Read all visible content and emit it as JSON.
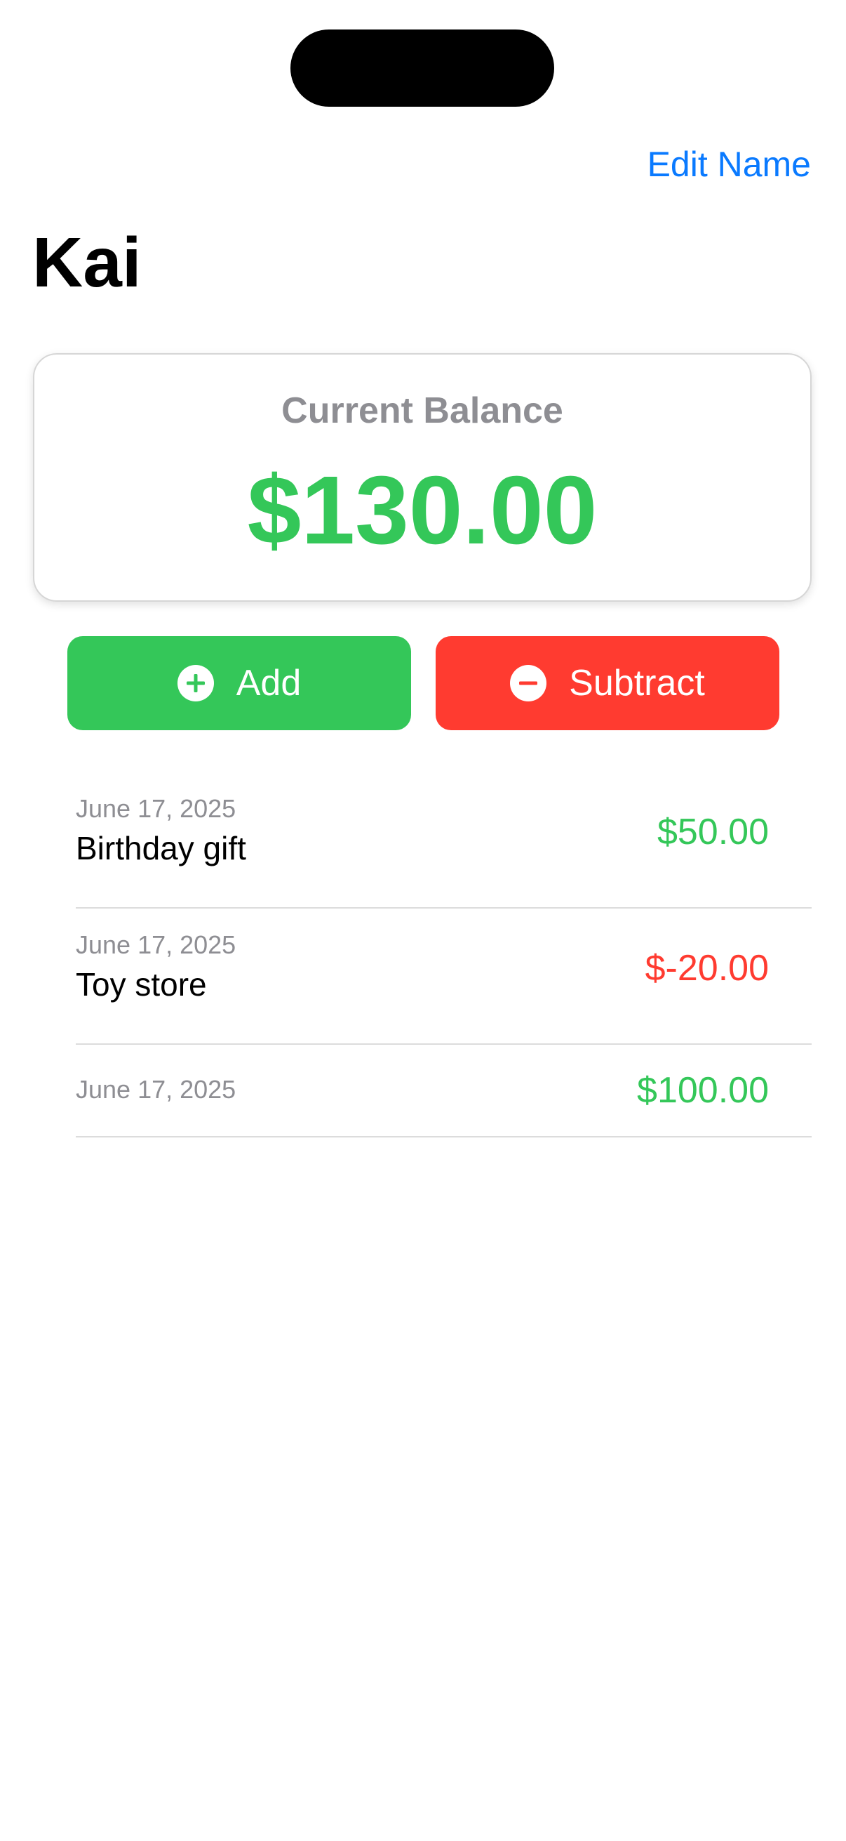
{
  "header": {
    "edit_name_label": "Edit Name",
    "title": "Kai"
  },
  "balance": {
    "label": "Current Balance",
    "amount": "$130.00"
  },
  "actions": {
    "add_label": "Add",
    "subtract_label": "Subtract",
    "add_icon": "plus-circle-icon",
    "subtract_icon": "minus-circle-icon"
  },
  "transactions": [
    {
      "date": "June 17, 2025",
      "description": "Birthday gift",
      "amount": "$50.00",
      "type": "credit"
    },
    {
      "date": "June 17, 2025",
      "description": "Toy store",
      "amount": "$-20.00",
      "type": "debit"
    },
    {
      "date": "June 17, 2025",
      "description": "",
      "amount": "$100.00",
      "type": "credit"
    }
  ],
  "colors": {
    "accent": "#0a7aff",
    "positive": "#34c759",
    "negative": "#ff3b30",
    "secondary_text": "#8e8e93"
  }
}
